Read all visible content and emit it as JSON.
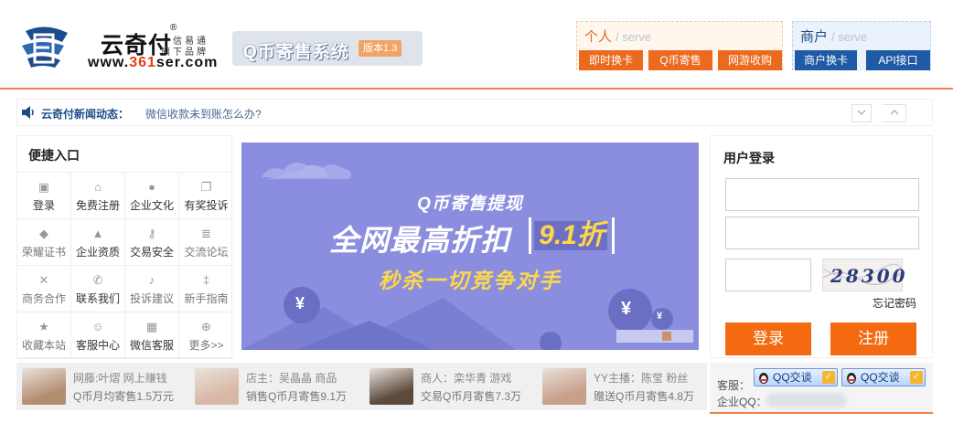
{
  "header": {
    "logo_cn": "云奇付",
    "logo_reg": "®",
    "slogan_line1": "一信易通",
    "slogan_line2": "旗下品牌",
    "logo_url_a": "www.",
    "logo_url_b": "361",
    "logo_url_c": "ser.com",
    "system_name": "Q币寄售系统",
    "version": "版本1.3"
  },
  "personal": {
    "title": "个人",
    "subtitle": "/ serve",
    "buttons": [
      "即时换卡",
      "Q币寄售",
      "网游收购"
    ]
  },
  "merchant": {
    "title": "商户",
    "subtitle": "/ serve",
    "buttons": [
      "商户换卡",
      "API接口"
    ]
  },
  "news": {
    "title": "云奇付新闻动态：",
    "link": "微信收款未到账怎么办?",
    "prev_icon": "chevron-down-icon",
    "next_icon": "chevron-up-icon"
  },
  "quick": {
    "title": "便捷入口",
    "items": [
      {
        "label": "登录",
        "icon": "id-card-icon",
        "glyph": "▣"
      },
      {
        "label": "免费注册",
        "icon": "home-icon",
        "glyph": "⌂"
      },
      {
        "label": "企业文化",
        "icon": "piggy-bank-icon",
        "glyph": "●"
      },
      {
        "label": "有奖投诉",
        "icon": "document-icon",
        "glyph": "❐"
      },
      {
        "label": "荣耀证书",
        "icon": "tag-icon",
        "glyph": "◆"
      },
      {
        "label": "企业资质",
        "icon": "lock-icon",
        "glyph": "▲"
      },
      {
        "label": "交易安全",
        "icon": "key-icon",
        "glyph": "⚷"
      },
      {
        "label": "交流论坛",
        "icon": "list-icon",
        "glyph": "≣"
      },
      {
        "label": "商务合作",
        "icon": "arrows-icon",
        "glyph": "✕"
      },
      {
        "label": "联系我们",
        "icon": "phone-icon",
        "glyph": "✆"
      },
      {
        "label": "投诉建议",
        "icon": "bell-icon",
        "glyph": "♪"
      },
      {
        "label": "新手指南",
        "icon": "signpost-icon",
        "glyph": "‡"
      },
      {
        "label": "收藏本站",
        "icon": "star-icon",
        "glyph": "★"
      },
      {
        "label": "客服中心",
        "icon": "user-icon",
        "glyph": "☺"
      },
      {
        "label": "微信客服",
        "icon": "qrcode-icon",
        "glyph": "▦"
      },
      {
        "label": "更多>>",
        "icon": "plus-circle-icon",
        "glyph": "⊕"
      }
    ]
  },
  "banner": {
    "subtitle": "Q币寄售提现",
    "main": "全网最高折扣",
    "tag": "9.1折",
    "slogan": "秒杀一切竞争对手",
    "currency_symbol": "¥"
  },
  "login": {
    "title": "用户登录",
    "username_value": "",
    "password_value": "",
    "captcha_value": "",
    "captcha_text": "28300",
    "forgot": "忘记密码",
    "login_button": "登录",
    "register_button": "注册"
  },
  "strip": [
    {
      "line1": "网藤:叶熠 网上赚钱",
      "line2": "Q币月均寄售1.5万元",
      "avatar_color": "#b48c70"
    },
    {
      "line1": "店主：吴晶晶 商品",
      "line2": "销售Q币月寄售9.1万",
      "avatar_color": "#d9b7a6"
    },
    {
      "line1": "商人：栾华青 游戏",
      "line2": "交易Q币月寄售7.3万",
      "avatar_color": "#5d4a3c"
    },
    {
      "line1": "YY主播：陈莹 粉丝",
      "line2": "赠送Q币月寄售4.8万",
      "avatar_color": "#c99e8a"
    }
  ],
  "service": {
    "label": "客服：",
    "label2": "企业QQ：",
    "qq1": "QQ交谈",
    "qq2": "QQ交谈",
    "check": "✓"
  }
}
